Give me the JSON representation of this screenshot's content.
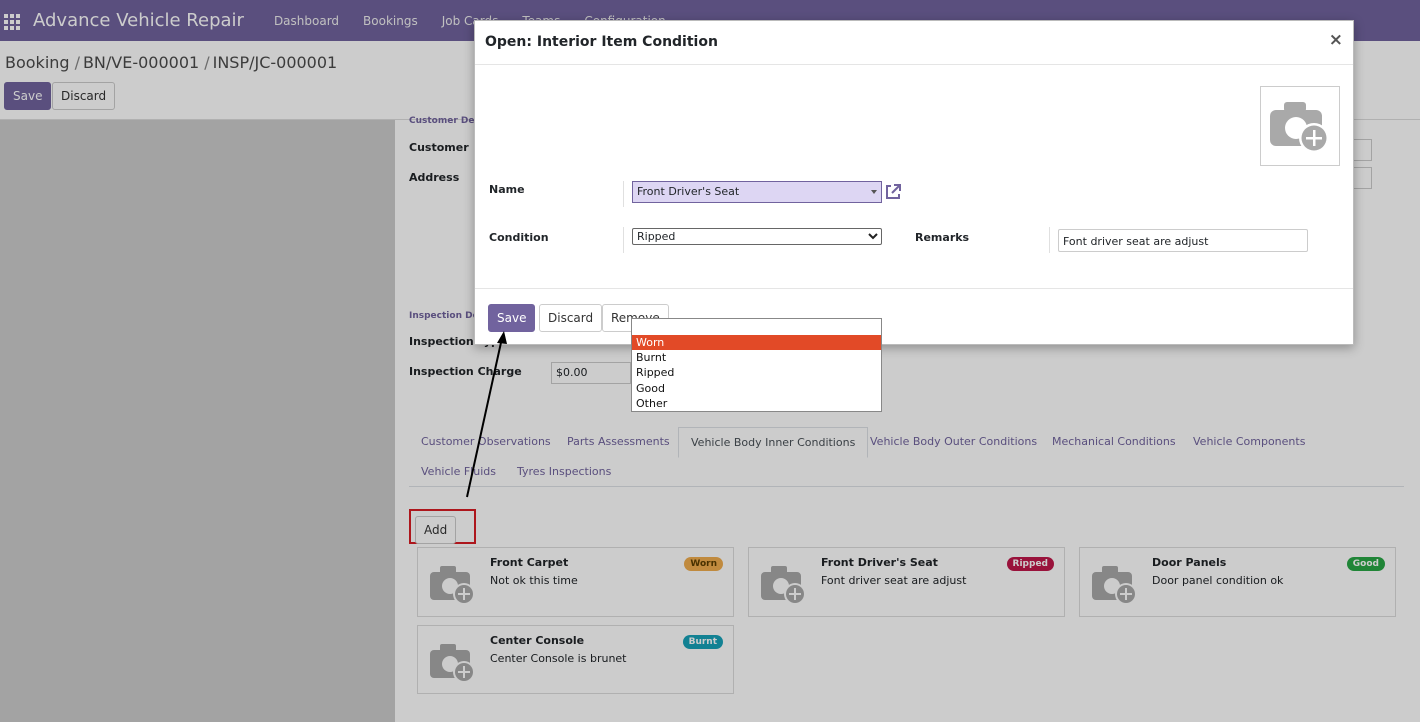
{
  "navbar": {
    "app_title": "Advance Vehicle Repair",
    "items": [
      "Dashboard",
      "Bookings",
      "Job Cards",
      "Teams",
      "Configuration"
    ]
  },
  "breadcrumb": [
    "Booking",
    "BN/VE-000001",
    "INSP/JC-000001"
  ],
  "control_panel": {
    "save_label": "Save",
    "discard_label": "Discard"
  },
  "form": {
    "customer_section": "Customer Details",
    "customer_label": "Customer",
    "address_label": "Address",
    "inspection_section": "Inspection Details",
    "inspection_type_label": "Inspection Type",
    "inspection_charge_label": "Inspection Charge",
    "inspection_charge_value": "$0.00"
  },
  "tabs": [
    "Customer Observations",
    "Parts Assessments",
    "Vehicle Body Inner Conditions",
    "Vehicle Body Outer Conditions",
    "Mechanical Conditions",
    "Vehicle Components",
    "Vehicle Fluids",
    "Tyres Inspections"
  ],
  "active_tab": "Vehicle Body Inner Conditions",
  "add_label": "Add",
  "cards": [
    {
      "title": "Front Carpet",
      "remark": "Not ok this time",
      "badge": "Worn",
      "badge_color": "#f0ad4e",
      "badge_text_color": "#5a3e00"
    },
    {
      "title": "Front Driver's Seat",
      "remark": "Font driver seat are adjust",
      "badge": "Ripped",
      "badge_color": "#c0174a",
      "badge_text_color": "#ffffff"
    },
    {
      "title": "Door Panels",
      "remark": "Door panel condition ok",
      "badge": "Good",
      "badge_color": "#28a745",
      "badge_text_color": "#ffffff"
    },
    {
      "title": "Center Console",
      "remark": "Center Console is brunet",
      "badge": "Burnt",
      "badge_color": "#17a2b8",
      "badge_text_color": "#ffffff"
    }
  ],
  "modal": {
    "title": "Open: Interior Item Condition",
    "close": "×",
    "name_label": "Name",
    "name_value": "Front Driver's Seat",
    "condition_label": "Condition",
    "condition_value": "Ripped",
    "remarks_label": "Remarks",
    "remarks_value": "Font driver seat are adjust",
    "save_label": "Save",
    "discard_label": "Discard",
    "remove_label": "Remove"
  },
  "dropdown": {
    "options": [
      "",
      "Worn",
      "Burnt",
      "Ripped",
      "Good",
      "Other"
    ],
    "highlighted": "Worn"
  },
  "colors": {
    "brand": "#71639e",
    "highlight": "#e24a27",
    "annotation_box": "#d91c24"
  }
}
